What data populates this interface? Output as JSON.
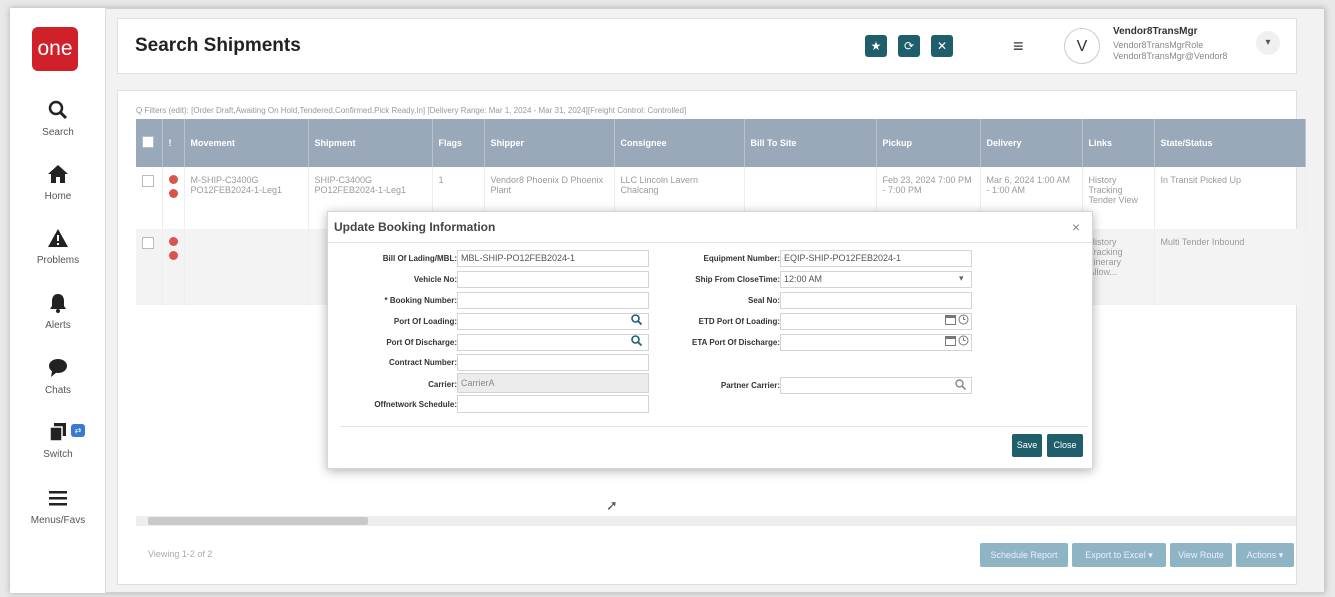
{
  "app": {
    "logo_text": "one"
  },
  "sidebar": {
    "items": [
      {
        "label": "Search",
        "icon": "search-icon"
      },
      {
        "label": "Home",
        "icon": "home-icon"
      },
      {
        "label": "Problems",
        "icon": "warning-icon"
      },
      {
        "label": "Alerts",
        "icon": "bell-icon"
      },
      {
        "label": "Chats",
        "icon": "chat-icon"
      },
      {
        "label": "Switch",
        "icon": "switch-icon"
      },
      {
        "label": "Menus/Favs",
        "icon": "menu-icon"
      }
    ]
  },
  "header": {
    "title": "Search Shipments",
    "user_initial": "V",
    "user_name": "Vendor8TransMgr",
    "user_role": "Vendor8TransMgrRole",
    "user_email": "Vendor8TransMgr@Vendor8"
  },
  "main": {
    "filters_text": "Q Filters (edit): [Order Draft,Awaiting On Hold,Tendered,Confirmed,Pick Ready,In] [Delivery Range: Mar 1, 2024 - Mar 31, 2024][Freight Control: Controlled]",
    "columns": [
      "Movement",
      "Shipment",
      "Flags",
      "Shipper",
      "Consignee",
      "Bill To Site",
      "Pickup",
      "Delivery",
      "Links",
      "State/Status"
    ],
    "rows": [
      {
        "movement": "M-SHIP-C3400G PO12FEB2024-1-Leg1",
        "shipment": "SHIP-C3400G PO12FEB2024-1-Leg1",
        "flags": "1",
        "shipper": "Vendor8 Phoenix D Phoenix Plant",
        "consignee": "LLC Lincoln Lavern Chalcang",
        "bill_to": "",
        "pickup": "Feb 23, 2024 7:00 PM - 7:00 PM",
        "delivery": "Mar 6, 2024 1:00 AM - 1:00 AM",
        "links": "History Tracking Tender View",
        "status": "In Transit Picked Up"
      },
      {
        "movement": "",
        "shipment": "",
        "flags": "",
        "shipper": "",
        "consignee": "",
        "bill_to": "",
        "pickup": "",
        "delivery": "",
        "links": "History Tracking Itinerary Allow...",
        "status": "Multi Tender Inbound"
      }
    ],
    "viewing": "Viewing 1-2 of 2",
    "footer_buttons": [
      "Schedule Report",
      "Export to Excel ▾",
      "View Route",
      "Actions ▾"
    ]
  },
  "modal": {
    "title": "Update Booking Information",
    "close_glyph": "×",
    "left_fields": [
      {
        "label": "Bill Of Lading/MBL:",
        "value": "MBL-SHIP-PO12FEB2024-1"
      },
      {
        "label": "Vehicle No:",
        "value": ""
      },
      {
        "label": "* Booking Number:",
        "value": ""
      },
      {
        "label": "Port Of Loading:",
        "value": ""
      },
      {
        "label": "Port Of Discharge:",
        "value": ""
      },
      {
        "label": "Contract Number:",
        "value": ""
      },
      {
        "label": "Carrier:",
        "value": "CarrierA"
      },
      {
        "label": "Offnetwork Schedule:",
        "value": ""
      }
    ],
    "right_fields": [
      {
        "label": "Equipment Number:",
        "value": "EQIP-SHIP-PO12FEB2024-1"
      },
      {
        "label": "Ship From CloseTime:",
        "value": "12:00 AM"
      },
      {
        "label": "Seal No:",
        "value": ""
      },
      {
        "label": "ETD Port Of Loading:",
        "value": ""
      },
      {
        "label": "ETA Port Of Discharge:",
        "value": ""
      },
      {
        "label": "Partner Carrier:",
        "value": ""
      }
    ],
    "save_label": "Save",
    "close_label": "Close"
  },
  "colors": {
    "brand": "#d0202a",
    "accent": "#1f5f6b",
    "grid_header": "#9aa9ba"
  }
}
